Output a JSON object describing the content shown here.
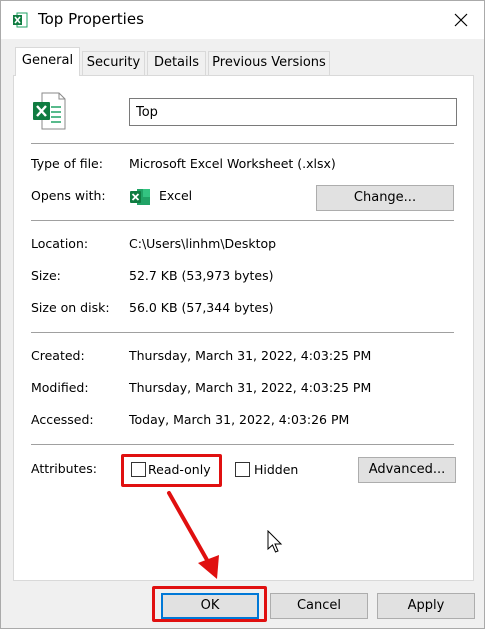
{
  "window": {
    "title": "Top Properties"
  },
  "tabs": [
    {
      "label": "General"
    },
    {
      "label": "Security"
    },
    {
      "label": "Details"
    },
    {
      "label": "Previous Versions"
    }
  ],
  "general": {
    "file_name": "Top",
    "type_label": "Type of file:",
    "type_value": "Microsoft Excel Worksheet (.xlsx)",
    "opens_label": "Opens with:",
    "opens_value": "Excel",
    "change_label": "Change...",
    "location_label": "Location:",
    "location_value": "C:\\Users\\linhm\\Desktop",
    "size_label": "Size:",
    "size_value": "52.7 KB (53,973 bytes)",
    "size_disk_label": "Size on disk:",
    "size_disk_value": "56.0 KB (57,344 bytes)",
    "created_label": "Created:",
    "created_value": "Thursday, March 31, 2022, 4:03:25 PM",
    "modified_label": "Modified:",
    "modified_value": "Thursday, March 31, 2022, 4:03:25 PM",
    "accessed_label": "Accessed:",
    "accessed_value": "Today, March 31, 2022, 4:03:26 PM",
    "attributes_label": "Attributes:",
    "readonly_label": "Read-only",
    "hidden_label": "Hidden",
    "advanced_label": "Advanced..."
  },
  "footer": {
    "ok_label": "OK",
    "cancel_label": "Cancel",
    "apply_label": "Apply"
  },
  "colors": {
    "highlight": "#e01010",
    "excel_green": "#107c41",
    "focus_blue": "#0078d7"
  }
}
